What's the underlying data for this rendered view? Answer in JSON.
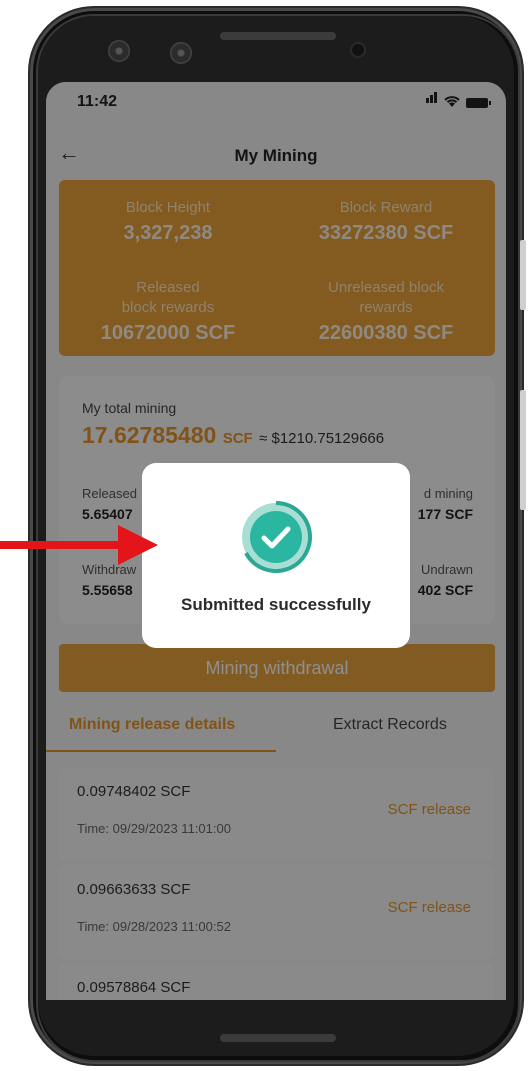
{
  "status_bar": {
    "time": "11:42"
  },
  "nav": {
    "title": "My Mining"
  },
  "stats": {
    "block_height_label": "Block Height",
    "block_height_value": "3,327,238",
    "block_reward_label": "Block Reward",
    "block_reward_value": "33272380 SCF",
    "released_label_line1": "Released",
    "released_label_line2": "block rewards",
    "released_value": "10672000 SCF",
    "unreleased_label_line1": "Unreleased block",
    "unreleased_label_line2": "rewards",
    "unreleased_value": "22600380 SCF"
  },
  "mining": {
    "total_label": "My total mining",
    "total_amount": "17.62785480",
    "total_unit": "SCF",
    "total_approx": "≈ $1210.75129666",
    "released_label": "Released",
    "released_value": "5.65407",
    "unreleased_label": "d mining",
    "unreleased_value": "177 SCF",
    "withdrawn_label": "Withdraw",
    "withdrawn_value": "5.55658",
    "undrawn_label": "Undrawn",
    "undrawn_value": "402 SCF"
  },
  "withdraw_button": "Mining withdrawal",
  "tabs": {
    "release_details": "Mining release details",
    "extract_records": "Extract Records"
  },
  "records": [
    {
      "amount": "0.09748402 SCF",
      "time": "Time: 09/29/2023 11:01:00",
      "status": "SCF release"
    },
    {
      "amount": "0.09663633 SCF",
      "time": "Time: 09/28/2023 11:00:52",
      "status": "SCF release"
    },
    {
      "amount": "0.09578864 SCF"
    }
  ],
  "dialog": {
    "message": "Submitted successfully"
  },
  "colors": {
    "accent": "#e7952a",
    "card": "#e9a13a",
    "success": "#2bb6a1",
    "arrow": "#e3151a"
  }
}
